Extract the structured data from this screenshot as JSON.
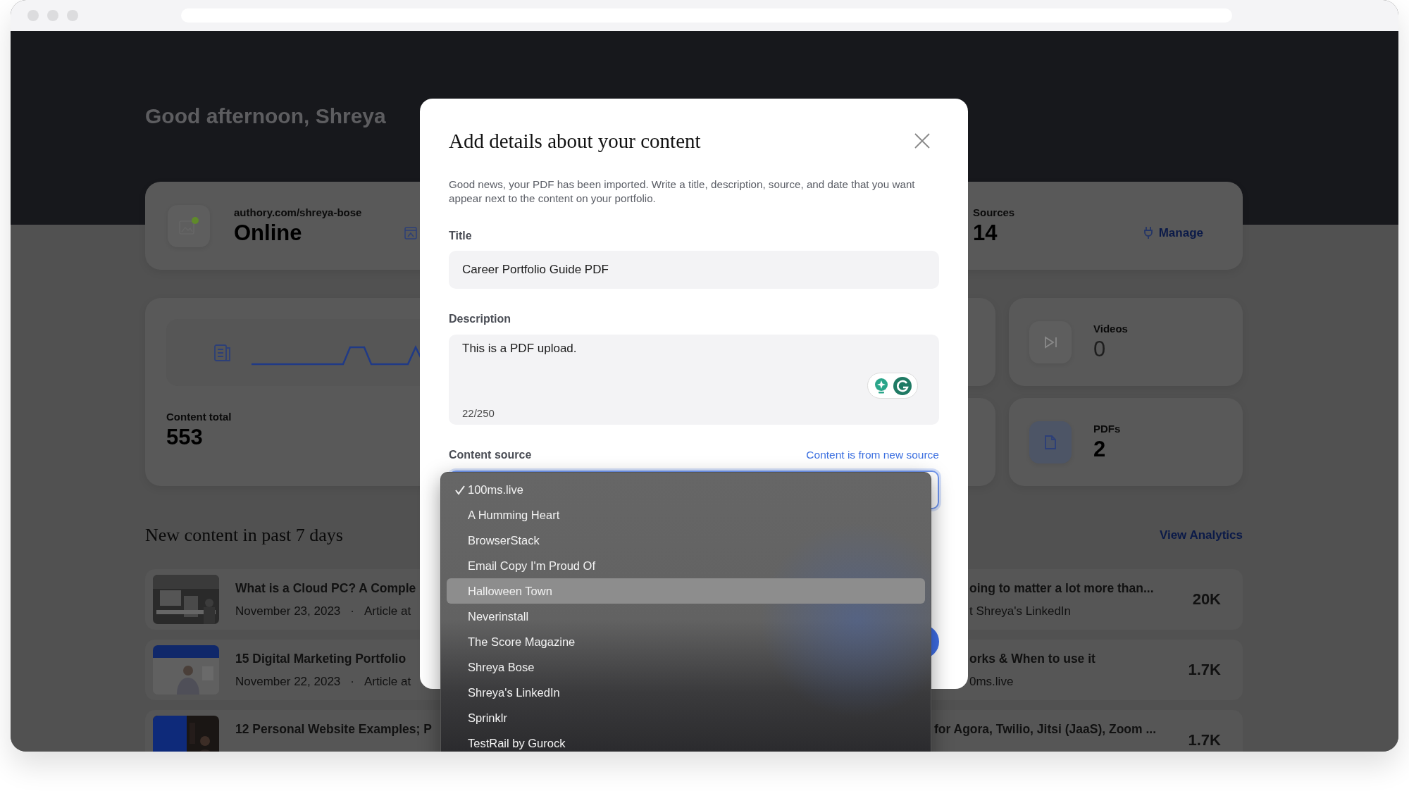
{
  "greeting": "Good afternoon, Shreya",
  "profile_card": {
    "url": "authory.com/shreya-bose",
    "status": "Online",
    "sources_label": "Sources",
    "sources_count": "14",
    "manage": "Manage"
  },
  "stats": {
    "total_label": "Content total",
    "total": "553",
    "tiles": [
      {
        "kind": "video",
        "label": "Videos",
        "value": "0",
        "disabled": true
      },
      {
        "kind": "pdf",
        "label": "PDFs",
        "value": "2",
        "disabled": false
      }
    ]
  },
  "recent": {
    "title": "New content in past 7 days",
    "link": "View Analytics",
    "rows": [
      {
        "title": "What is a Cloud PC? A Comple",
        "date": "November 23, 2023",
        "separator": "·",
        "meta": "Article at",
        "title_right": "oing to matter a lot more than...",
        "meta_right": "t Shreya's LinkedIn",
        "views": "20K"
      },
      {
        "title": "15 Digital Marketing Portfolio",
        "date": "November 22, 2023",
        "separator": "·",
        "meta": "Article at",
        "title_right": "orks & When to use it",
        "meta_right": "0ms.live",
        "views": "1.7K"
      },
      {
        "title": "12 Personal Website Examples; P",
        "title_right": "for Agora, Twilio, Jitsi (JaaS), Zoom ...",
        "views": "1.7K"
      }
    ]
  },
  "modal": {
    "title": "Add details about your content",
    "intro": "Good news, your PDF has been imported. Write a title, description, source, and date that you want appear next to the content on your portfolio.",
    "title_label": "Title",
    "title_value": "Career Portfolio Guide PDF",
    "description_label": "Description",
    "description_value": "This is a PDF upload.",
    "description_count": "22/250",
    "source_label": "Content source",
    "source_link": "Content is from new source",
    "source_options": [
      {
        "label": "100ms.live",
        "checked": true,
        "highlighted": false
      },
      {
        "label": "A Humming Heart",
        "checked": false,
        "highlighted": false
      },
      {
        "label": "BrowserStack",
        "checked": false,
        "highlighted": false
      },
      {
        "label": "Email Copy I'm Proud Of",
        "checked": false,
        "highlighted": false
      },
      {
        "label": "Halloween Town",
        "checked": false,
        "highlighted": true
      },
      {
        "label": "Neverinstall",
        "checked": false,
        "highlighted": false
      },
      {
        "label": "The Score Magazine",
        "checked": false,
        "highlighted": false
      },
      {
        "label": "Shreya Bose",
        "checked": false,
        "highlighted": false
      },
      {
        "label": "Shreya's LinkedIn",
        "checked": false,
        "highlighted": false
      },
      {
        "label": "Sprinklr",
        "checked": false,
        "highlighted": false
      },
      {
        "label": "TestRail by Gurock",
        "checked": false,
        "highlighted": false
      }
    ]
  }
}
